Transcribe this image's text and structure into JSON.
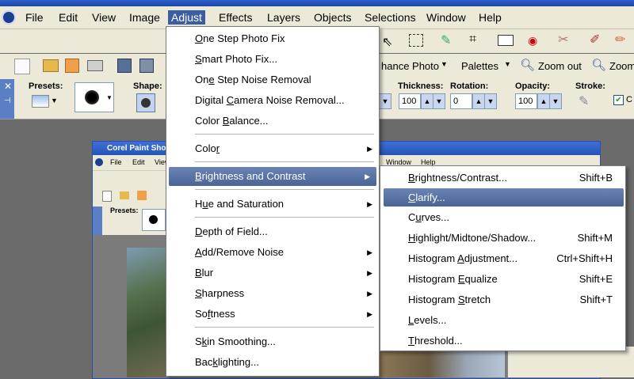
{
  "menubar": {
    "items": [
      "File",
      "Edit",
      "View",
      "Image",
      "Adjust",
      "Effects",
      "Layers",
      "Objects",
      "Selections",
      "Window",
      "Help"
    ]
  },
  "toolbar2": {
    "enhance_photo": "hance Photo",
    "palettes": "Palettes",
    "zoom_out": "Zoom out",
    "zoom_in": "Zoom"
  },
  "tool_options": {
    "presets_label": "Presets:",
    "shape_label": "Shape:",
    "thickness_label": "Thickness:",
    "thickness_value": "100",
    "rotation_label": "Rotation:",
    "rotation_value": "0",
    "opacity_label": "Opacity:",
    "opacity_value": "100",
    "stroke_label": "Stroke:",
    "left_spin_value": "100",
    "checkbox_label": "C"
  },
  "adjust_menu": {
    "items": [
      {
        "label": "One Step Photo Fix",
        "mn": "O",
        "rest": "ne Step Photo Fix"
      },
      {
        "label": "Smart Photo Fix...",
        "mn": "S",
        "rest": "mart Photo Fix..."
      },
      {
        "label": "One Step Noise Removal",
        "pre": "On",
        "mn": "e",
        "rest": " Step Noise Removal"
      },
      {
        "label": "Digital Camera Noise Removal...",
        "pre": "Digital ",
        "mn": "C",
        "rest": "amera Noise Removal..."
      },
      {
        "label": "Color Balance...",
        "pre": "Color ",
        "mn": "B",
        "rest": "alance..."
      },
      {
        "label": "Color",
        "pre": "Colo",
        "mn": "r",
        "rest": ""
      },
      {
        "label": "Brightness and Contrast",
        "pre": "",
        "mn": "B",
        "rest": "rightness and Contrast"
      },
      {
        "label": "Hue and Saturation",
        "pre": "H",
        "mn": "u",
        "rest": "e and Saturation"
      },
      {
        "label": "Depth of Field...",
        "pre": "",
        "mn": "D",
        "rest": "epth of Field..."
      },
      {
        "label": "Add/Remove Noise",
        "pre": "",
        "mn": "A",
        "rest": "dd/Remove Noise"
      },
      {
        "label": "Blur",
        "pre": "",
        "mn": "B",
        "rest": "lur"
      },
      {
        "label": "Sharpness",
        "pre": "",
        "mn": "S",
        "rest": "harpness"
      },
      {
        "label": "Softness",
        "pre": "So",
        "mn": "f",
        "rest": "tness"
      },
      {
        "label": "Skin Smoothing...",
        "pre": "S",
        "mn": "k",
        "rest": "in Smoothing..."
      },
      {
        "label": "Backlighting...",
        "pre": "Bac",
        "mn": "k",
        "rest": "lighting..."
      }
    ]
  },
  "bc_submenu": {
    "items": [
      {
        "pre": "",
        "mn": "B",
        "rest": "rightness/Contrast...",
        "shortcut": "Shift+B"
      },
      {
        "pre": "",
        "mn": "C",
        "rest": "larify...",
        "shortcut": ""
      },
      {
        "pre": "C",
        "mn": "u",
        "rest": "rves...",
        "shortcut": ""
      },
      {
        "pre": "",
        "mn": "H",
        "rest": "ighlight/Midtone/Shadow...",
        "shortcut": "Shift+M"
      },
      {
        "pre": "Histogram ",
        "mn": "A",
        "rest": "djustment...",
        "shortcut": "Ctrl+Shift+H"
      },
      {
        "pre": "Histogram ",
        "mn": "E",
        "rest": "qualize",
        "shortcut": "Shift+E"
      },
      {
        "pre": "Histogram ",
        "mn": "S",
        "rest": "tretch",
        "shortcut": "Shift+T"
      },
      {
        "pre": "",
        "mn": "L",
        "rest": "evels...",
        "shortcut": ""
      },
      {
        "pre": "",
        "mn": "T",
        "rest": "hreshold...",
        "shortcut": ""
      }
    ]
  },
  "inner_window": {
    "title": "Corel Paint Sho",
    "menu": [
      "File",
      "Edit",
      "View"
    ],
    "menu_right": [
      "Window",
      "Help"
    ],
    "presets_label": "Presets:"
  },
  "colors": {
    "highlight": "#4a6496",
    "menubar": "#ece9d8",
    "titlebar": "#2c5fc9"
  }
}
